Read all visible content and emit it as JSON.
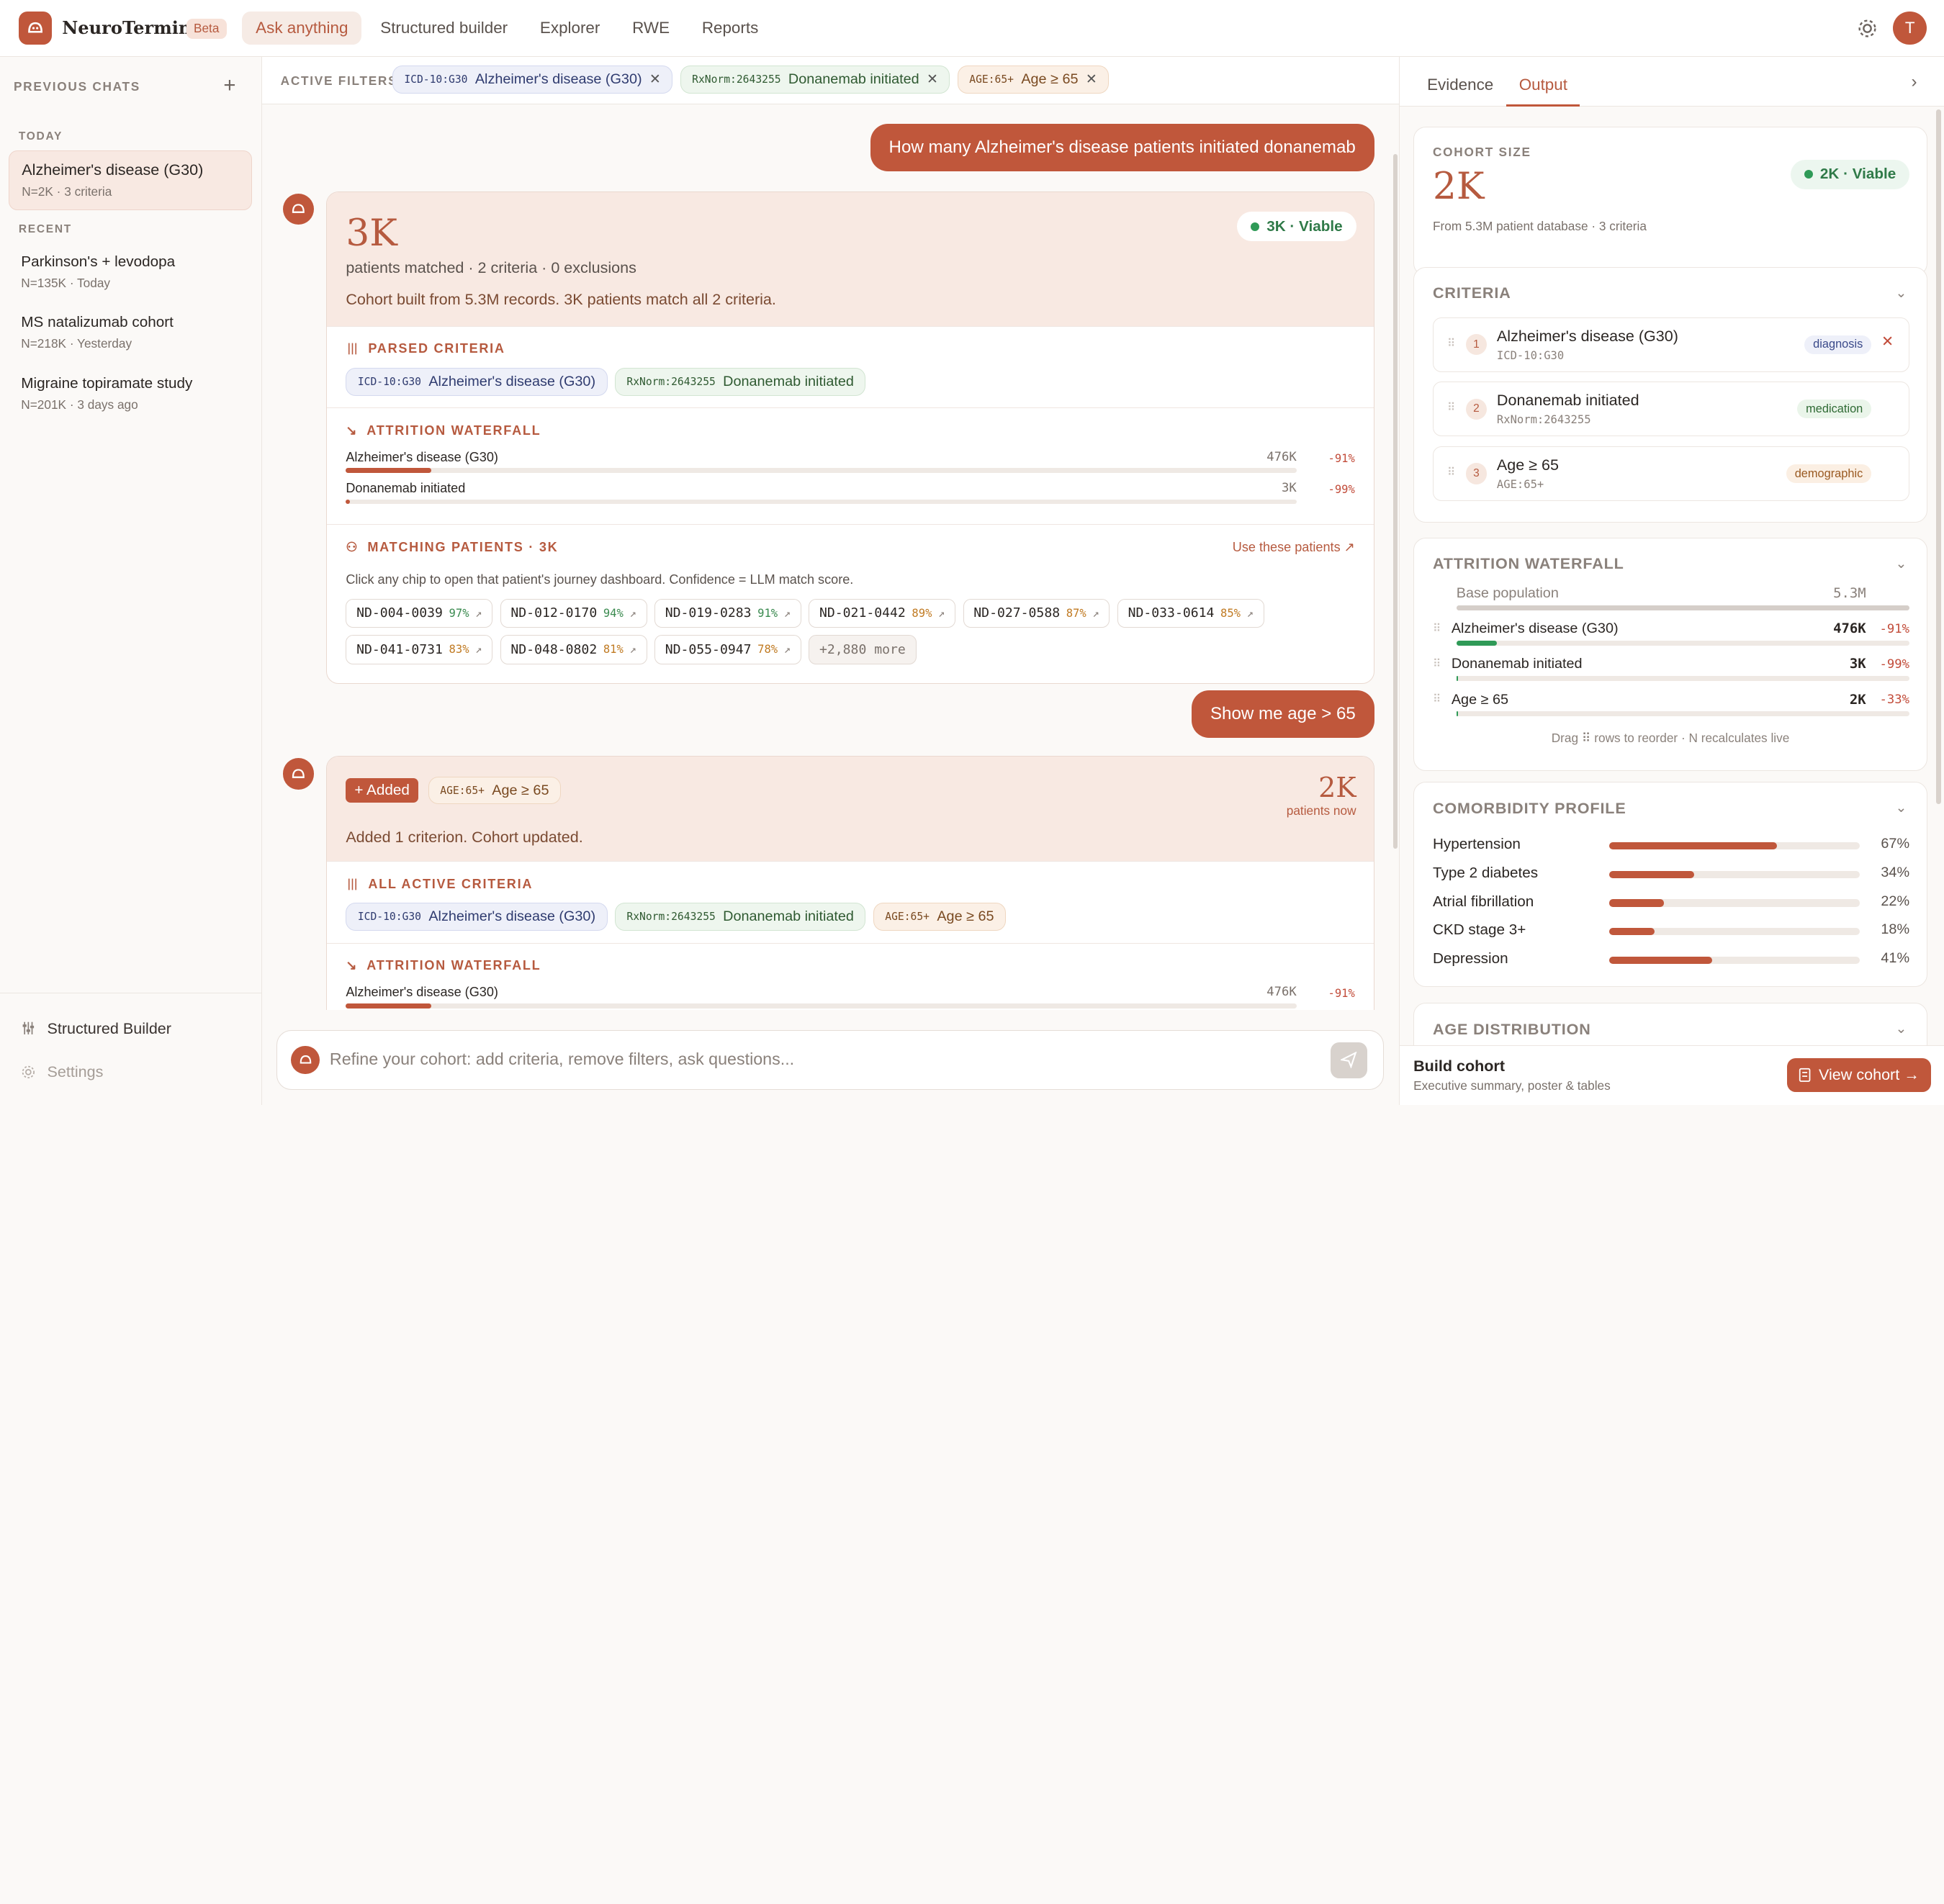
{
  "app": {
    "name": "NeuroTerminal",
    "badge": "Beta",
    "user_initial": "T"
  },
  "nav": [
    "Ask anything",
    "Structured builder",
    "Explorer",
    "RWE",
    "Reports"
  ],
  "sidebar": {
    "heading": "PREVIOUS CHATS",
    "today_label": "TODAY",
    "recent_label": "RECENT",
    "today": [
      {
        "title": "Alzheimer's disease (G30)",
        "sub": "N=2K · 3 criteria"
      }
    ],
    "recent": [
      {
        "title": "Parkinson's + levodopa",
        "sub": "N=135K · Today"
      },
      {
        "title": "MS natalizumab cohort",
        "sub": "N=218K · Yesterday"
      },
      {
        "title": "Migraine topiramate study",
        "sub": "N=201K · 3 days ago"
      }
    ],
    "footer": {
      "builder": "Structured Builder",
      "settings": "Settings"
    }
  },
  "filters": {
    "label": "ACTIVE FILTERS",
    "chips": [
      {
        "code": "ICD-10:G30",
        "label": "Alzheimer's disease (G30)"
      },
      {
        "code": "RxNorm:2643255",
        "label": "Donanemab initiated"
      },
      {
        "code": "AGE:65+",
        "label": "Age ≥ 65"
      }
    ]
  },
  "chat": {
    "q1": "How many Alzheimer's disease patients initiated donanemab",
    "r1": {
      "count": "3K",
      "viable": "3K · Viable",
      "sub": "patients matched · 2 criteria · 0 exclusions",
      "desc": "Cohort built from 5.3M records. 3K patients match all 2 criteria.",
      "parsed_label": "PARSED CRITERIA",
      "waterfall_label": "ATTRITION WATERFALL",
      "waterfall": [
        {
          "name": "Alzheimer's disease (G30)",
          "value": "476K",
          "pct": "-91%",
          "fill": 0.09
        },
        {
          "name": "Donanemab initiated",
          "value": "3K",
          "pct": "-99%",
          "fill": 0.002
        }
      ],
      "matching_label": "MATCHING PATIENTS · 3K",
      "use_link": "Use these patients ↗",
      "hint": "Click any chip to open that patient's journey dashboard. Confidence = LLM match score.",
      "patients": [
        {
          "id": "ND-004-0039",
          "c": "97%",
          "color": "#3a8a4f"
        },
        {
          "id": "ND-012-0170",
          "c": "94%",
          "color": "#3a8a4f"
        },
        {
          "id": "ND-019-0283",
          "c": "91%",
          "color": "#3a8a4f"
        },
        {
          "id": "ND-021-0442",
          "c": "89%",
          "color": "#c07a22"
        },
        {
          "id": "ND-027-0588",
          "c": "87%",
          "color": "#c07a22"
        },
        {
          "id": "ND-033-0614",
          "c": "85%",
          "color": "#c07a22"
        },
        {
          "id": "ND-041-0731",
          "c": "83%",
          "color": "#c07a22"
        },
        {
          "id": "ND-048-0802",
          "c": "81%",
          "color": "#c07a22"
        },
        {
          "id": "ND-055-0947",
          "c": "78%",
          "color": "#c07a22"
        }
      ],
      "more": "+2,880 more"
    },
    "q2": "Show me age > 65",
    "r2": {
      "added": "+ Added",
      "count": "2K",
      "count_sub": "patients now",
      "desc": "Added 1 criterion. Cohort updated.",
      "active_label": "ALL ACTIVE CRITERIA",
      "waterfall_label": "ATTRITION WATERFALL",
      "wf_row": {
        "name": "Alzheimer's disease (G30)",
        "value": "476K",
        "pct": "-91%"
      }
    }
  },
  "input": {
    "placeholder": "Refine your cohort: add criteria, remove filters, ask questions..."
  },
  "right": {
    "tabs": [
      "Evidence",
      "Output"
    ],
    "cohort": {
      "label": "COHORT SIZE",
      "value": "2K",
      "viable": "2K · Viable",
      "sub": "From 5.3M patient database · 3 criteria"
    },
    "criteria_label": "CRITERIA",
    "criteria": [
      {
        "n": "1",
        "name": "Alzheimer's disease (G30)",
        "code": "ICD-10:G30",
        "tag": "diagnosis",
        "bg": "#eef0f9",
        "fg": "#3b4a8a"
      },
      {
        "n": "2",
        "name": "Donanemab initiated",
        "code": "RxNorm:2643255",
        "tag": "medication",
        "bg": "#eaf5ea",
        "fg": "#2f6a34"
      },
      {
        "n": "3",
        "name": "Age ≥ 65",
        "code": "AGE:65+",
        "tag": "demographic",
        "bg": "#fbefe3",
        "fg": "#9a5a22"
      }
    ],
    "waterfall_label": "ATTRITION WATERFALL",
    "waterfall": [
      {
        "name": "Base population",
        "value": "5.3M",
        "pct": "",
        "fill": 1.0,
        "color": "#d5cec9"
      },
      {
        "name": "Alzheimer's disease (G30)",
        "value": "476K",
        "pct": "-91%",
        "fill": 0.09,
        "color": "#2f9a57"
      },
      {
        "name": "Donanemab initiated",
        "value": "3K",
        "pct": "-99%",
        "fill": 0.001,
        "color": "#2f9a57"
      },
      {
        "name": "Age ≥ 65",
        "value": "2K",
        "pct": "-33%",
        "fill": 0.0006,
        "color": "#2f9a57"
      }
    ],
    "drag_hint": "Drag ⠿ rows to reorder · N recalculates live",
    "comorbidity_label": "COMORBIDITY PROFILE",
    "comorbidity": [
      {
        "name": "Hypertension",
        "value": "67%",
        "fill": 0.67
      },
      {
        "name": "Type 2 diabetes",
        "value": "34%",
        "fill": 0.34
      },
      {
        "name": "Atrial fibrillation",
        "value": "22%",
        "fill": 0.22
      },
      {
        "name": "CKD stage 3+",
        "value": "18%",
        "fill": 0.18
      },
      {
        "name": "Depression",
        "value": "41%",
        "fill": 0.41
      }
    ],
    "age_label": "AGE DISTRIBUTION",
    "build": {
      "title": "Build cohort",
      "sub": "Executive summary, poster & tables",
      "button": "View cohort →"
    }
  }
}
